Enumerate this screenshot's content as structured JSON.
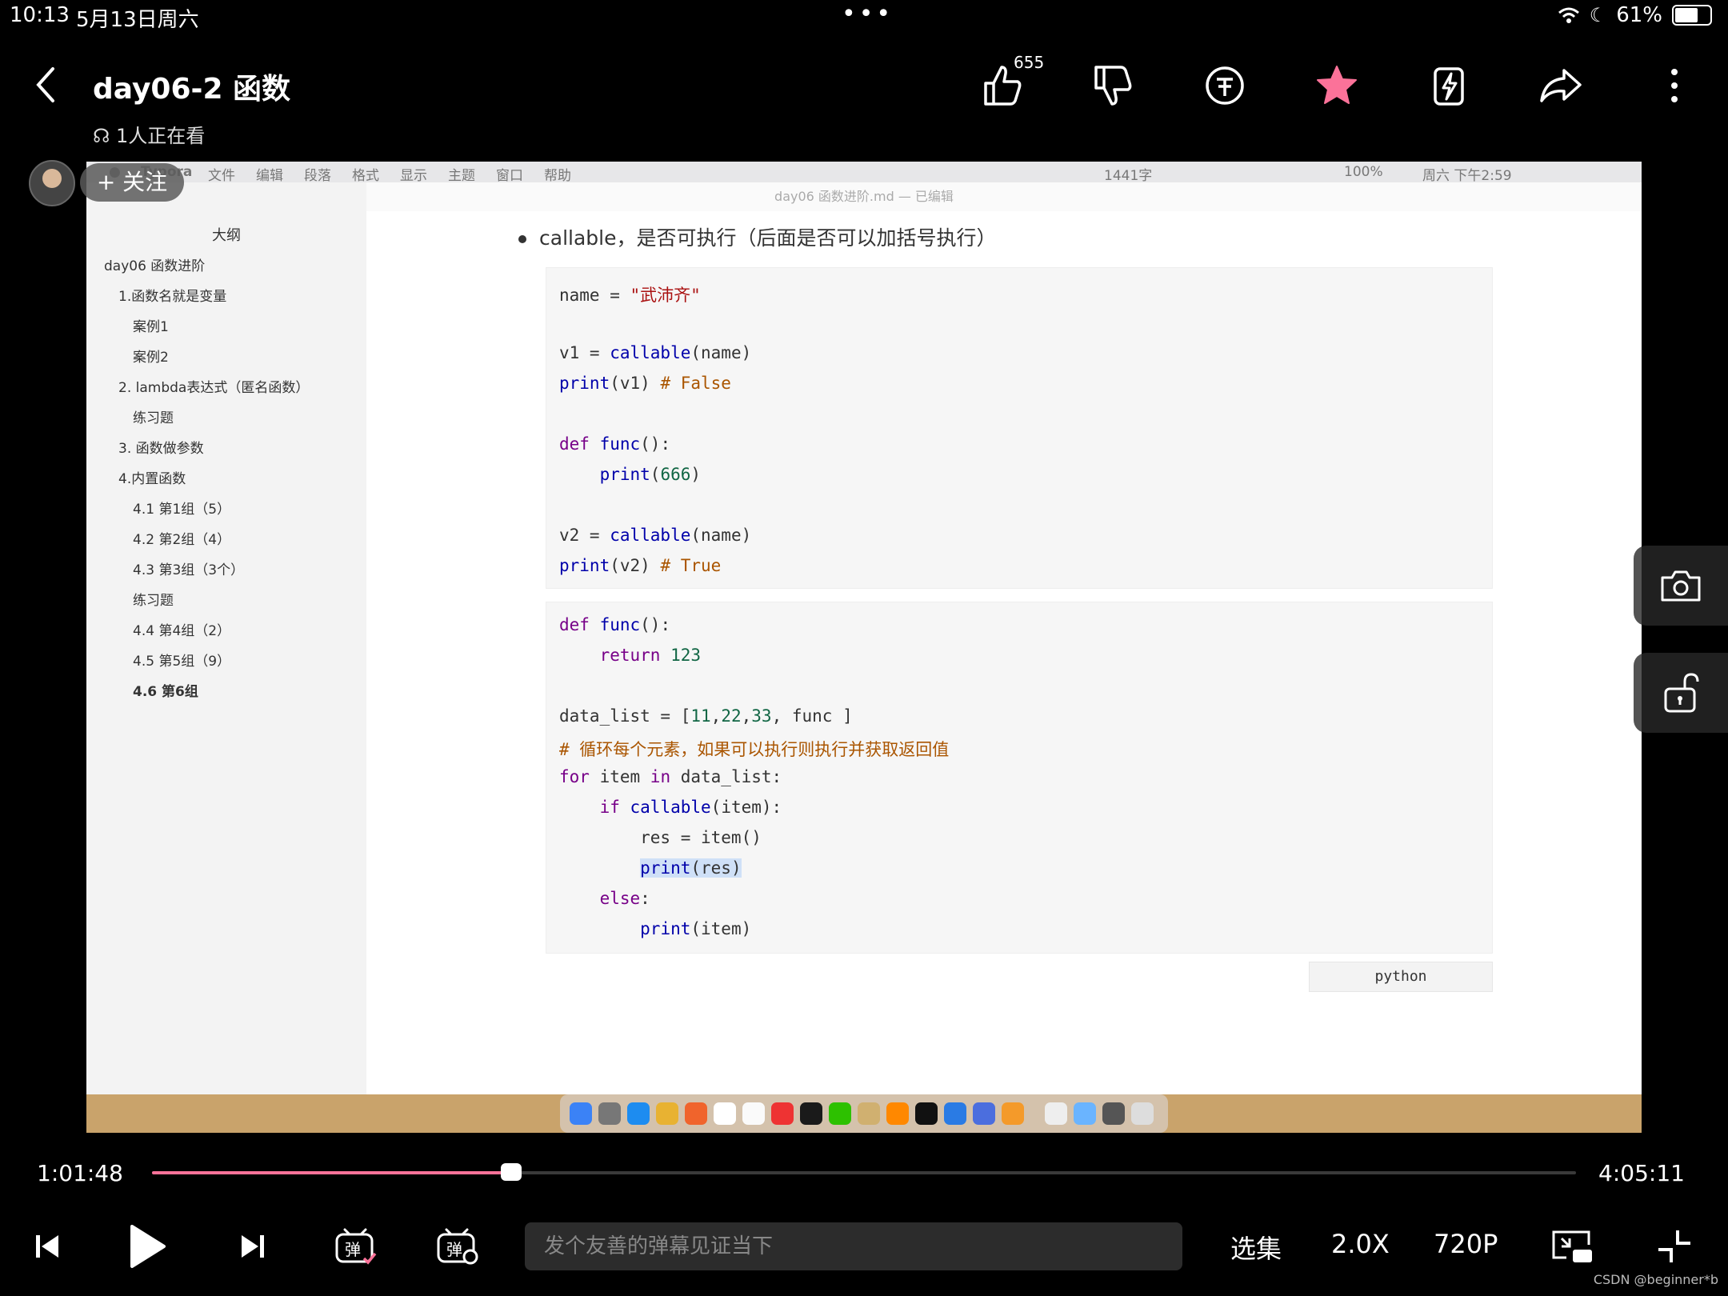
{
  "status_bar": {
    "time": "10:13",
    "date": "5月13日周六",
    "battery": "61%"
  },
  "header": {
    "title": "day06-2 函数",
    "watching": "1人正在看",
    "like_count": "655",
    "follow_label": "+ 关注"
  },
  "video": {
    "mac_menu": [
      "Typora",
      "文件",
      "编辑",
      "段落",
      "格式",
      "显示",
      "主题",
      "窗口",
      "帮助"
    ],
    "mac_menu_right": [
      "1441字",
      "100%",
      "周六 下午2:59"
    ],
    "window_title": "day06 函数进阶.md — 已编辑",
    "outline_header": "大纲",
    "outline": [
      "day06 函数进阶",
      "1.函数名就是变量",
      "案例1",
      "案例2",
      "2. lambda表达式（匿名函数）",
      "练习题",
      "3. 函数做参数",
      "4.内置函数",
      "4.1 第1组（5）",
      "4.2 第2组（4）",
      "4.3 第3组（3个）",
      "练习题",
      "4.4 第4组（2）",
      "4.5 第5组（9）",
      "4.6 第6组"
    ],
    "bullet": "callable，是否可执行（后面是否可以加括号执行）",
    "code1": {
      "l1_a": "name = ",
      "l1_b": "\"武沛齐\"",
      "l2_a": "v1 = ",
      "l2_b": "callable",
      "l2_c": "(name)",
      "l3_a": "print",
      "l3_b": "(v1) ",
      "l3_c": "# False",
      "l4_a": "def ",
      "l4_b": "func",
      "l4_c": "():",
      "l5_a": "    ",
      "l5_b": "print",
      "l5_c": "(",
      "l5_d": "666",
      "l5_e": ")",
      "l6_a": "v2 = ",
      "l6_b": "callable",
      "l6_c": "(name)",
      "l7_a": "print",
      "l7_b": "(v2) ",
      "l7_c": "# True"
    },
    "code2": {
      "l1_a": "def ",
      "l1_b": "func",
      "l1_c": "():",
      "l2_a": "    ",
      "l2_b": "return ",
      "l2_c": "123",
      "l3_a": "data_list = [",
      "l3_b": "11",
      "l3_c": ",",
      "l3_d": "22",
      "l3_e": ",",
      "l3_f": "33",
      "l3_g": ", func ]",
      "l4": "# 循环每个元素，如果可以执行则执行并获取返回值",
      "l5_a": "for ",
      "l5_b": "item ",
      "l5_c": "in ",
      "l5_d": "data_list:",
      "l6_a": "    ",
      "l6_b": "if ",
      "l6_c": "callable",
      "l6_d": "(item):",
      "l7": "        res = item()",
      "l8_a": "        ",
      "l8_b": "print",
      "l8_c": "(res)",
      "l9_a": "    ",
      "l9_b": "else",
      "l9_c": ":",
      "l10_a": "        ",
      "l10_b": "print",
      "l10_c": "(item)"
    },
    "code_lang": "python"
  },
  "player": {
    "current_time": "1:01:48",
    "total_time": "4:05:11",
    "progress": 0.252,
    "danmaku_placeholder": "发个友善的弹幕见证当下",
    "episodes_label": "选集",
    "speed_label": "2.0X",
    "quality_label": "720P",
    "accent_color": "#fb7299"
  },
  "watermark": "CSDN @beginner*b"
}
